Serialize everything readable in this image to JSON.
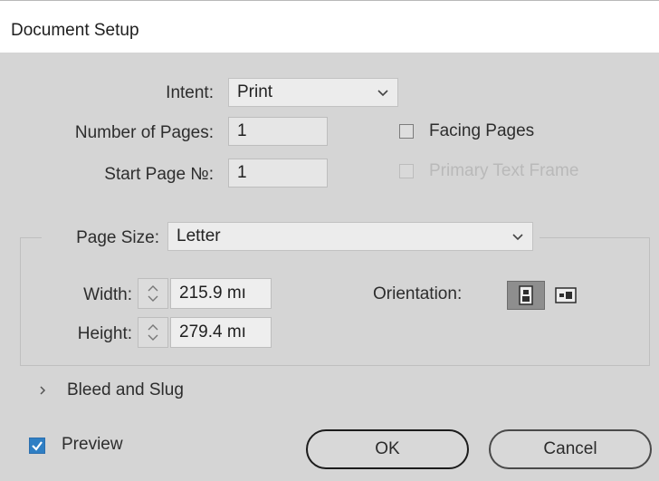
{
  "window": {
    "title": "Document Setup"
  },
  "intent": {
    "label": "Intent:",
    "value": "Print"
  },
  "pages": {
    "number_label": "Number of Pages:",
    "number_value": "1",
    "start_label": "Start Page №:",
    "start_value": "1",
    "facing_label": "Facing Pages",
    "facing_checked": false,
    "primary_frame_label": "Primary Text Frame",
    "primary_frame_checked": false
  },
  "page_size": {
    "label": "Page Size:",
    "value": "Letter",
    "width_label": "Width:",
    "width_value": "215.9 mı",
    "height_label": "Height:",
    "height_value": "279.4 mı",
    "orientation_label": "Orientation:",
    "orientation_selected": "portrait"
  },
  "bleed": {
    "label": "Bleed and Slug",
    "expanded": false
  },
  "footer": {
    "preview_label": "Preview",
    "preview_checked": true,
    "ok_label": "OK",
    "cancel_label": "Cancel"
  },
  "colors": {
    "accent": "#2f7fc4",
    "background": "#d6d6d6"
  }
}
